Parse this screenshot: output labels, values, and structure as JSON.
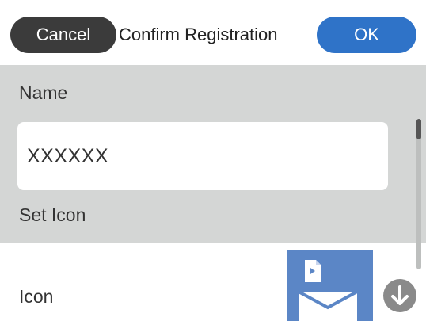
{
  "header": {
    "cancel_label": "Cancel",
    "title": "Confirm Registration",
    "ok_label": "OK"
  },
  "form": {
    "name_label": "Name",
    "name_value": "XXXXXX",
    "set_icon_label": "Set Icon"
  },
  "icon_row": {
    "label": "Icon",
    "preview_icon": "document-to-envelope-icon",
    "action_icon": "arrow-down-circle-icon"
  },
  "colors": {
    "accent": "#2f73c8",
    "cancel_bg": "#3b3b3b",
    "panel_bg": "#d4d6d5",
    "icon_tile": "#5b86c6"
  }
}
